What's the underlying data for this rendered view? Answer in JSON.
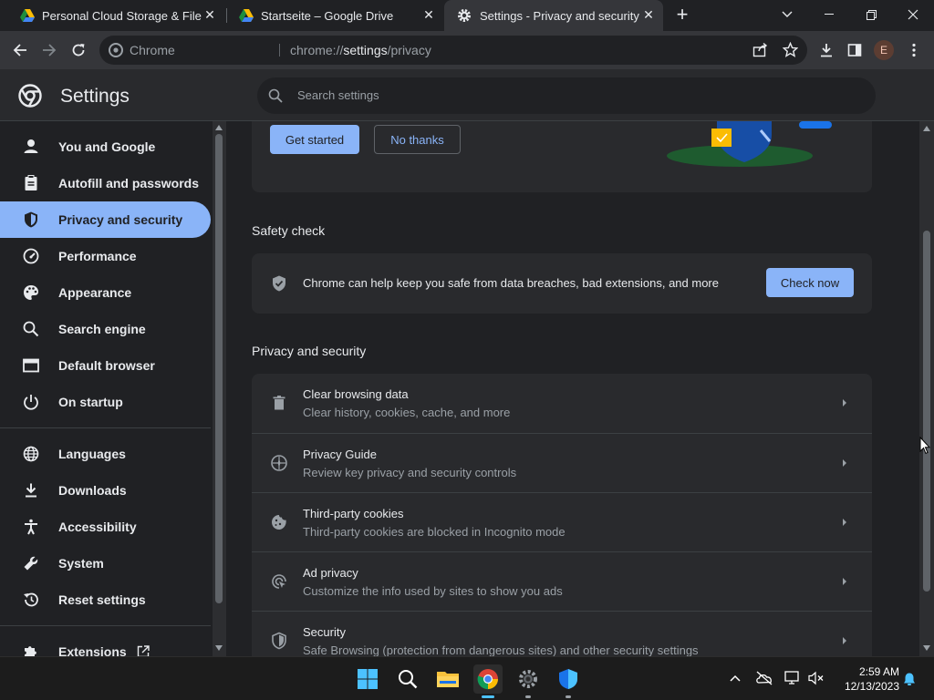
{
  "tabs": [
    {
      "title": "Personal Cloud Storage & File Sh",
      "icon": "google-drive-icon"
    },
    {
      "title": "Startseite – Google Drive",
      "icon": "google-drive-icon"
    },
    {
      "title": "Settings - Privacy and security",
      "icon": "gear-icon"
    }
  ],
  "new_tab_label": "+",
  "omnibox": {
    "chip_label": "Chrome",
    "url_prefix": "chrome://",
    "url_host": "settings",
    "url_path": "/privacy"
  },
  "profile_initial": "E",
  "settings": {
    "title": "Settings",
    "search_placeholder": "Search settings"
  },
  "sidebar": {
    "items": [
      {
        "label": "You and Google",
        "icon": "person-icon"
      },
      {
        "label": "Autofill and passwords",
        "icon": "clipboard-icon"
      },
      {
        "label": "Privacy and security",
        "icon": "shield-icon",
        "active": true
      },
      {
        "label": "Performance",
        "icon": "gauge-icon"
      },
      {
        "label": "Appearance",
        "icon": "palette-icon"
      },
      {
        "label": "Search engine",
        "icon": "search-icon"
      },
      {
        "label": "Default browser",
        "icon": "browser-icon"
      },
      {
        "label": "On startup",
        "icon": "power-icon"
      },
      {
        "label": "Languages",
        "icon": "globe-icon"
      },
      {
        "label": "Downloads",
        "icon": "download-icon"
      },
      {
        "label": "Accessibility",
        "icon": "accessibility-icon"
      },
      {
        "label": "System",
        "icon": "wrench-icon"
      },
      {
        "label": "Reset settings",
        "icon": "history-icon"
      },
      {
        "label": "Extensions",
        "icon": "puzzle-icon"
      }
    ]
  },
  "promo": {
    "get_started_label": "Get started",
    "no_thanks_label": "No thanks"
  },
  "safety_check": {
    "heading": "Safety check",
    "text": "Chrome can help keep you safe from data breaches, bad extensions, and more",
    "button_label": "Check now"
  },
  "privacy": {
    "heading": "Privacy and security",
    "rows": [
      {
        "title": "Clear browsing data",
        "subtitle": "Clear history, cookies, cache, and more",
        "icon": "trash-icon"
      },
      {
        "title": "Privacy Guide",
        "subtitle": "Review key privacy and security controls",
        "icon": "compass-icon"
      },
      {
        "title": "Third-party cookies",
        "subtitle": "Third-party cookies are blocked in Incognito mode",
        "icon": "cookie-icon"
      },
      {
        "title": "Ad privacy",
        "subtitle": "Customize the info used by sites to show you ads",
        "icon": "ad-privacy-icon"
      },
      {
        "title": "Security",
        "subtitle": "Safe Browsing (protection from dangerous sites) and other security settings",
        "icon": "shield-icon"
      }
    ]
  },
  "taskbar": {
    "apps": [
      "windows-start-icon",
      "search-icon",
      "file-explorer-icon",
      "chrome-icon",
      "settings-icon",
      "defender-icon"
    ],
    "time": "2:59 AM",
    "date": "12/13/2023"
  },
  "colors": {
    "accent": "#8ab4f8",
    "background": "#202124",
    "surface": "#292a2d"
  }
}
